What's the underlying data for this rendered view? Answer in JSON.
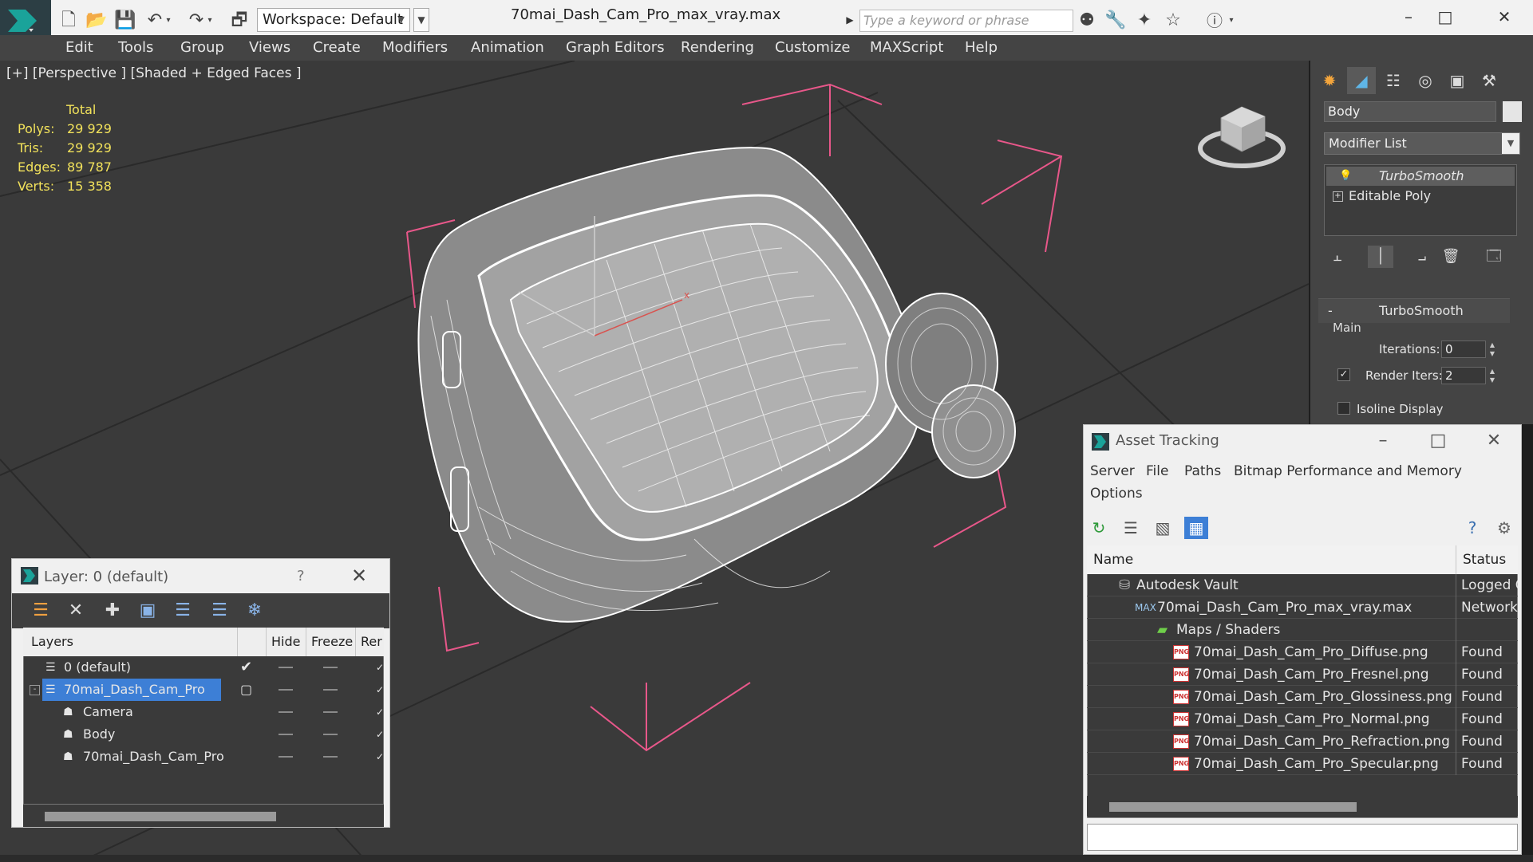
{
  "app": {
    "logo_icon": "3dsmax-logo-icon",
    "accent": "#1aa39a"
  },
  "titlebar": {
    "workspace_label": "Workspace: Default",
    "file_title": "70mai_Dash_Cam_Pro_max_vray.max",
    "search_placeholder": "Type a keyword or phrase"
  },
  "menu": [
    "Edit",
    "Tools",
    "Group",
    "Views",
    "Create",
    "Modifiers",
    "Animation",
    "Graph Editors",
    "Rendering",
    "Customize",
    "MAXScript",
    "Help"
  ],
  "viewport": {
    "label": "[+] [Perspective ] [Shaded + Edged Faces ]",
    "stats_header": "Total",
    "stats": [
      {
        "label": "Polys:",
        "value": "29 929"
      },
      {
        "label": "Tris:",
        "value": "29 929"
      },
      {
        "label": "Edges:",
        "value": "89 787"
      },
      {
        "label": "Verts:",
        "value": "15 358"
      }
    ],
    "stats_color": "#f2e25b",
    "wire_color": "#ffffff",
    "bbox_color": "#e8578a"
  },
  "command_panel": {
    "object_name": "Body",
    "modifier_list_label": "Modifier List",
    "stack": [
      {
        "label": "TurboSmooth",
        "italic": true,
        "icon": "lightbulb-icon"
      },
      {
        "label": "Editable Poly",
        "italic": false,
        "icon": "expand-plus-icon"
      }
    ],
    "rollout_title": "TurboSmooth",
    "group_label": "Main",
    "iterations_label": "Iterations:",
    "iterations_value": "0",
    "render_iters_label": "Render Iters:",
    "render_iters_value": "2",
    "render_iters_checked": true,
    "isoline_label": "Isoline Display",
    "isoline_checked": false
  },
  "layer_dialog": {
    "title": "Layer: 0 (default)",
    "help": "?",
    "columns": [
      "Layers",
      "Hide",
      "Freeze",
      "Rer"
    ],
    "rows": [
      {
        "name": "0 (default)",
        "indent": 0,
        "icon": "layer-stack-icon",
        "selected": false,
        "current": true
      },
      {
        "name": "70mai_Dash_Cam_Pro",
        "indent": 0,
        "icon": "layer-stack-icon",
        "selected": true,
        "current": false
      },
      {
        "name": "Camera",
        "indent": 1,
        "icon": "object-teapot-icon",
        "selected": false,
        "current": false
      },
      {
        "name": "Body",
        "indent": 1,
        "icon": "object-teapot-icon",
        "selected": false,
        "current": false
      },
      {
        "name": "70mai_Dash_Cam_Pro",
        "indent": 1,
        "icon": "object-teapot-icon",
        "selected": false,
        "current": false
      }
    ],
    "selection_color": "#3d7fd6"
  },
  "asset_tracking": {
    "title": "Asset Tracking",
    "menu": [
      "Server",
      "File",
      "Paths",
      "Bitmap Performance and Memory",
      "Options"
    ],
    "columns": [
      "Name",
      "Status"
    ],
    "rows": [
      {
        "name": "Autodesk Vault",
        "status": "Logged O",
        "indent": 0,
        "icon": "vault-icon"
      },
      {
        "name": "70mai_Dash_Cam_Pro_max_vray.max",
        "status": "Network F",
        "indent": 1,
        "icon": "max-file-icon"
      },
      {
        "name": "Maps / Shaders",
        "status": "",
        "indent": 2,
        "icon": "maps-folder-icon"
      },
      {
        "name": "70mai_Dash_Cam_Pro_Diffuse.png",
        "status": "Found",
        "indent": 3,
        "icon": "png-file-icon"
      },
      {
        "name": "70mai_Dash_Cam_Pro_Fresnel.png",
        "status": "Found",
        "indent": 3,
        "icon": "png-file-icon"
      },
      {
        "name": "70mai_Dash_Cam_Pro_Glossiness.png",
        "status": "Found",
        "indent": 3,
        "icon": "png-file-icon"
      },
      {
        "name": "70mai_Dash_Cam_Pro_Normal.png",
        "status": "Found",
        "indent": 3,
        "icon": "png-file-icon"
      },
      {
        "name": "70mai_Dash_Cam_Pro_Refraction.png",
        "status": "Found",
        "indent": 3,
        "icon": "png-file-icon"
      },
      {
        "name": "70mai_Dash_Cam_Pro_Specular.png",
        "status": "Found",
        "indent": 3,
        "icon": "png-file-icon"
      }
    ]
  }
}
